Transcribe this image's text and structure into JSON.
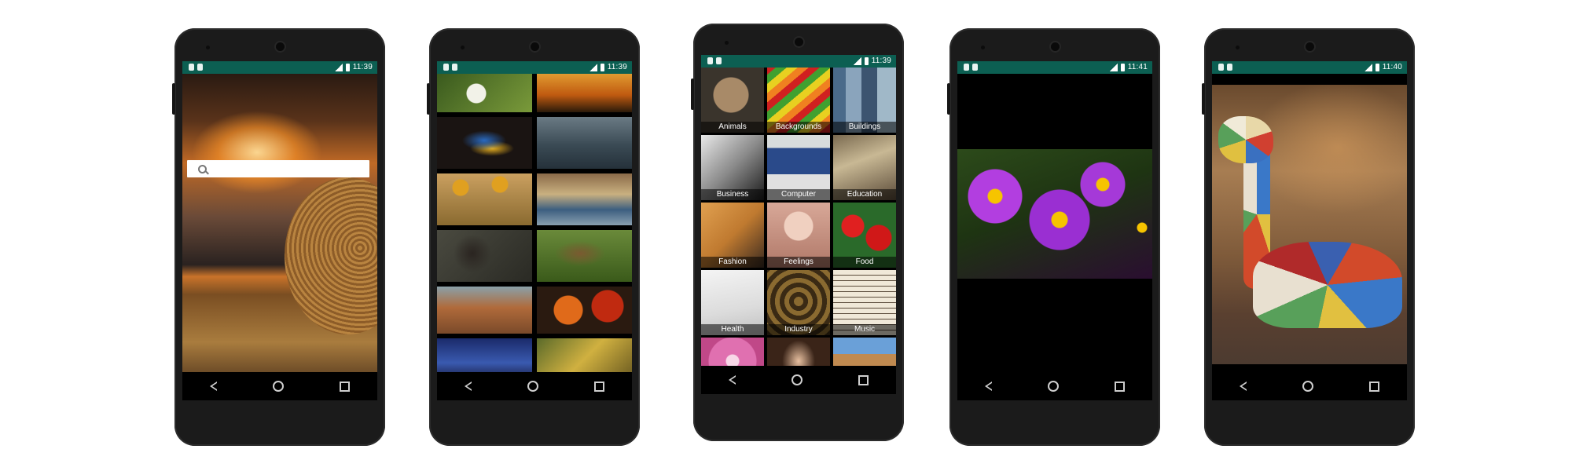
{
  "statusbar": {
    "phone1_time": "11:39",
    "phone2_time": "11:39",
    "phone3_time": "11:39",
    "phone4_time": "11:41",
    "phone5_time": "11:40"
  },
  "search": {
    "placeholder": ""
  },
  "categories": [
    "Animals",
    "Backgrounds",
    "Buildings",
    "Business",
    "Computer",
    "Education",
    "Fashion",
    "Feelings",
    "Food",
    "Health",
    "Industry",
    "Music"
  ],
  "colors": {
    "statusbar": "#0c5f52",
    "navbar": "#000000",
    "phone_body": "#1b1b1b"
  },
  "icons": {
    "search": "search-icon",
    "back": "back-icon",
    "home": "home-icon",
    "recents": "recents-icon"
  }
}
